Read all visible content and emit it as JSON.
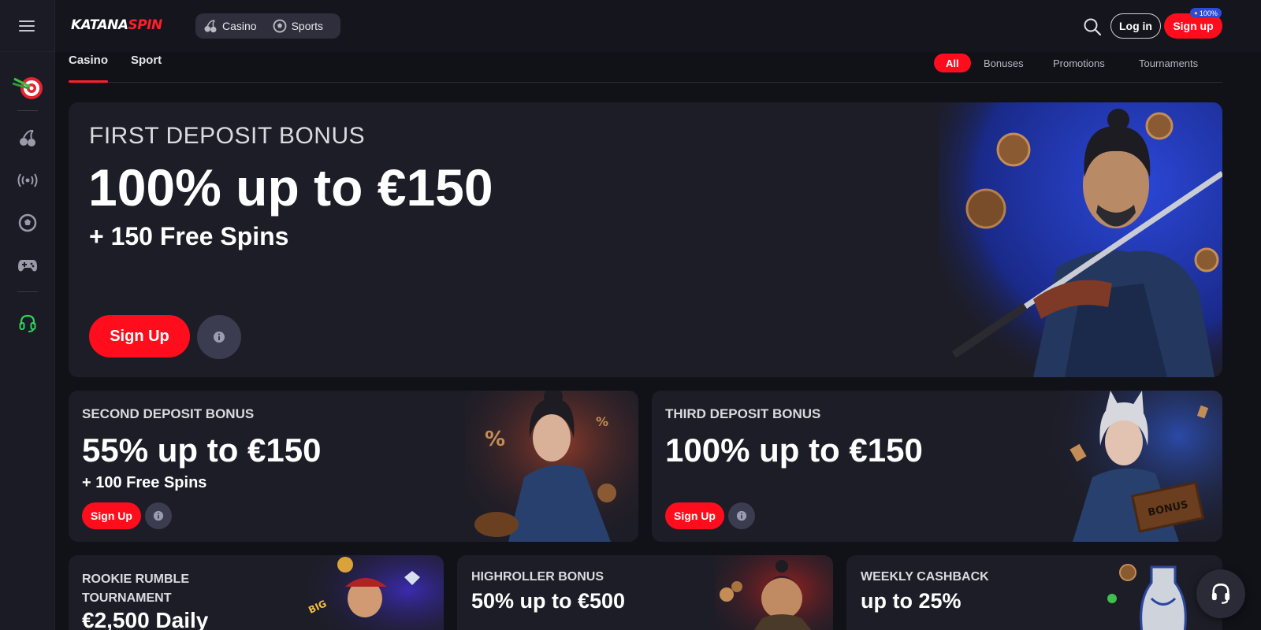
{
  "header": {
    "logo_part1": "KATANA",
    "logo_part2": "SPIN",
    "categories": [
      {
        "label": "Casino",
        "icon": "cherry-icon"
      },
      {
        "label": "Sports",
        "icon": "soccer-ball-icon"
      }
    ],
    "login_label": "Log in",
    "signup_label": "Sign up",
    "badge_text": "100%"
  },
  "sidebar": {
    "icons": [
      "menu-icon",
      "darts-icon",
      "cherry-icon",
      "live-broadcast-icon",
      "soccer-ball-icon",
      "gamepad-icon",
      "headset-icon"
    ]
  },
  "subnav": {
    "tabs": [
      "Casino",
      "Sport"
    ],
    "filters": [
      "All",
      "Bonuses",
      "Promotions",
      "Tournaments"
    ]
  },
  "hero": {
    "label": "FIRST DEPOSIT BONUS",
    "title": "100% up to €150",
    "subtitle": "+ 150 Free Spins",
    "button": "Sign Up"
  },
  "promo_second": {
    "label": "SECOND DEPOSIT BONUS",
    "title": "55% up to €150",
    "subtitle": "+ 100 Free Spins",
    "button": "Sign Up"
  },
  "promo_third": {
    "label": "THIRD DEPOSIT BONUS",
    "title": "100% up to €150",
    "button": "Sign Up",
    "box_text": "BONUS"
  },
  "bottom_cards": [
    {
      "label": "ROOKIE RUMBLE TOURNAMENT",
      "title": "€2,500 Daily"
    },
    {
      "label": "HIGHROLLER BONUS",
      "title": "50% up to €500"
    },
    {
      "label": "WEEKLY CASHBACK",
      "title": "up to 25%"
    }
  ],
  "colors": {
    "accent": "#ff0d1c",
    "background": "#111118",
    "card": "#1d1d27",
    "support_green": "#2fd15a"
  }
}
